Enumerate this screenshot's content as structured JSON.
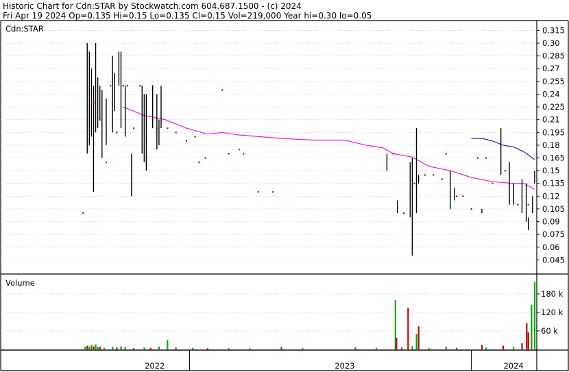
{
  "header": {
    "line1": "Historic Chart for Cdn:STAR by Stockwatch.com 604.687.1500 - (c) 2024",
    "line2": "Fri Apr 19 2024   Op=0.135   Hi=0.15   Lo=0.135   Cl=0.15   Vol=219,000   Year hi=0.30   lo=0.05"
  },
  "colors": {
    "background": "#ffffff",
    "grid": "#c8c8c8",
    "price_bar": "#000000",
    "price_dot": "#cc0000",
    "ma_long": "#e020e0",
    "ma_short": "#2020c0",
    "volume_up": "#00aa00",
    "volume_down": "#cc0000",
    "volume_flat": "#000000"
  },
  "chart_data": [
    {
      "type": "ohlc",
      "panel": "price",
      "symbol_label": "Cdn:STAR",
      "ylim": [
        0.03,
        0.325
      ],
      "y_ticks": [
        "0.315",
        "0.30",
        "0.285",
        "0.27",
        "0.255",
        "0.24",
        "0.225",
        "0.21",
        "0.195",
        "0.18",
        "0.165",
        "0.15",
        "0.135",
        "0.12",
        "0.105",
        "0.09",
        "0.075",
        "0.06",
        "0.045"
      ],
      "grid": true,
      "x_range": [
        2021.77,
        2024.31
      ],
      "bars": [
        {
          "x": 2022.18,
          "hi": 0.3,
          "lo": 0.17
        },
        {
          "x": 2022.19,
          "hi": 0.29,
          "lo": 0.18
        },
        {
          "x": 2022.2,
          "hi": 0.27,
          "lo": 0.19
        },
        {
          "x": 2022.21,
          "hi": 0.25,
          "lo": 0.125
        },
        {
          "x": 2022.22,
          "hi": 0.3,
          "lo": 0.195
        },
        {
          "x": 2022.23,
          "hi": 0.26,
          "lo": 0.2
        },
        {
          "x": 2022.24,
          "hi": 0.25,
          "lo": 0.21
        },
        {
          "x": 2022.25,
          "hi": 0.245,
          "lo": 0.165
        },
        {
          "x": 2022.27,
          "hi": 0.235,
          "lo": 0.18
        },
        {
          "x": 2022.3,
          "hi": 0.285,
          "lo": 0.195
        },
        {
          "x": 2022.31,
          "hi": 0.265,
          "lo": 0.22
        },
        {
          "x": 2022.33,
          "hi": 0.29,
          "lo": 0.25
        },
        {
          "x": 2022.34,
          "hi": 0.29,
          "lo": 0.2
        },
        {
          "x": 2022.36,
          "hi": 0.25,
          "lo": 0.19
        },
        {
          "x": 2022.39,
          "hi": 0.17,
          "lo": 0.12
        },
        {
          "x": 2022.44,
          "hi": 0.25,
          "lo": 0.17
        },
        {
          "x": 2022.45,
          "hi": 0.24,
          "lo": 0.16
        },
        {
          "x": 2022.46,
          "hi": 0.24,
          "lo": 0.15
        },
        {
          "x": 2022.49,
          "hi": 0.25,
          "lo": 0.2
        },
        {
          "x": 2022.51,
          "hi": 0.24,
          "lo": 0.175
        },
        {
          "x": 2022.52,
          "hi": 0.21,
          "lo": 0.18
        },
        {
          "x": 2022.53,
          "hi": 0.25,
          "lo": 0.2
        },
        {
          "x": 2023.6,
          "hi": 0.17,
          "lo": 0.15
        },
        {
          "x": 2023.65,
          "hi": 0.115,
          "lo": 0.1
        },
        {
          "x": 2023.71,
          "hi": 0.16,
          "lo": 0.095
        },
        {
          "x": 2023.72,
          "hi": 0.165,
          "lo": 0.05
        },
        {
          "x": 2023.74,
          "hi": 0.2,
          "lo": 0.1
        },
        {
          "x": 2023.75,
          "hi": 0.145,
          "lo": 0.135
        },
        {
          "x": 2023.9,
          "hi": 0.15,
          "lo": 0.105
        },
        {
          "x": 2023.92,
          "hi": 0.13,
          "lo": 0.115
        },
        {
          "x": 2024.05,
          "hi": 0.105,
          "lo": 0.1
        },
        {
          "x": 2024.14,
          "hi": 0.2,
          "lo": 0.145
        },
        {
          "x": 2024.18,
          "hi": 0.16,
          "lo": 0.11
        },
        {
          "x": 2024.2,
          "hi": 0.135,
          "lo": 0.11
        },
        {
          "x": 2024.24,
          "hi": 0.14,
          "lo": 0.1
        },
        {
          "x": 2024.26,
          "hi": 0.135,
          "lo": 0.09
        },
        {
          "x": 2024.27,
          "hi": 0.095,
          "lo": 0.08
        },
        {
          "x": 2024.29,
          "hi": 0.12,
          "lo": 0.1
        },
        {
          "x": 2024.3,
          "hi": 0.15,
          "lo": 0.135
        }
      ],
      "dots": [
        [
          2022.16,
          0.1
        ],
        [
          2022.21,
          0.23
        ],
        [
          2022.24,
          0.21
        ],
        [
          2022.27,
          0.16
        ],
        [
          2022.29,
          0.25
        ],
        [
          2022.32,
          0.195
        ],
        [
          2022.35,
          0.25
        ],
        [
          2022.37,
          0.25
        ],
        [
          2022.4,
          0.2
        ],
        [
          2022.43,
          0.25
        ],
        [
          2022.46,
          0.165
        ],
        [
          2022.49,
          0.25
        ],
        [
          2022.51,
          0.2
        ],
        [
          2022.53,
          0.21
        ],
        [
          2022.56,
          0.2
        ],
        [
          2022.6,
          0.195
        ],
        [
          2022.65,
          0.185
        ],
        [
          2022.69,
          0.19
        ],
        [
          2022.71,
          0.16
        ],
        [
          2022.74,
          0.165
        ],
        [
          2022.82,
          0.245
        ],
        [
          2022.85,
          0.17
        ],
        [
          2022.9,
          0.175
        ],
        [
          2022.92,
          0.17
        ],
        [
          2022.99,
          0.125
        ],
        [
          2023.06,
          0.125
        ],
        [
          2023.63,
          0.17
        ],
        [
          2023.68,
          0.1
        ],
        [
          2023.73,
          0.135
        ],
        [
          2023.78,
          0.145
        ],
        [
          2023.82,
          0.145
        ],
        [
          2023.86,
          0.14
        ],
        [
          2023.88,
          0.17
        ],
        [
          2023.93,
          0.12
        ],
        [
          2023.96,
          0.12
        ],
        [
          2024.0,
          0.105
        ],
        [
          2024.03,
          0.165
        ],
        [
          2024.07,
          0.165
        ],
        [
          2024.1,
          0.135
        ],
        [
          2024.16,
          0.15
        ],
        [
          2024.22,
          0.11
        ],
        [
          2024.27,
          0.11
        ]
      ],
      "series": [
        {
          "color_key": "ma_long",
          "points": [
            [
              2022.35,
              0.225
            ],
            [
              2022.45,
              0.215
            ],
            [
              2022.55,
              0.21
            ],
            [
              2022.65,
              0.2
            ],
            [
              2022.75,
              0.193
            ],
            [
              2022.82,
              0.195
            ],
            [
              2022.9,
              0.192
            ],
            [
              2023.0,
              0.19
            ],
            [
              2023.1,
              0.188
            ],
            [
              2023.25,
              0.186
            ],
            [
              2023.4,
              0.186
            ],
            [
              2023.5,
              0.18
            ],
            [
              2023.58,
              0.177
            ],
            [
              2023.63,
              0.17
            ],
            [
              2023.72,
              0.166
            ],
            [
              2023.8,
              0.155
            ],
            [
              2023.9,
              0.15
            ],
            [
              2024.0,
              0.142
            ],
            [
              2024.1,
              0.137
            ],
            [
              2024.2,
              0.135
            ],
            [
              2024.25,
              0.135
            ],
            [
              2024.3,
              0.128
            ]
          ]
        },
        {
          "color_key": "ma_short",
          "points": [
            [
              2024.0,
              0.188
            ],
            [
              2024.05,
              0.188
            ],
            [
              2024.1,
              0.185
            ],
            [
              2024.15,
              0.18
            ],
            [
              2024.2,
              0.178
            ],
            [
              2024.25,
              0.172
            ],
            [
              2024.3,
              0.163
            ]
          ]
        }
      ]
    },
    {
      "type": "bar",
      "panel": "volume",
      "panel_label": "Volume",
      "ylim": [
        0,
        240000
      ],
      "y_ticks": [
        "180 k",
        "120 k",
        "60 k"
      ],
      "grid": true,
      "bars": [
        {
          "x": 2022.17,
          "v": 8000,
          "c": "volume_up"
        },
        {
          "x": 2022.18,
          "v": 12000,
          "c": "volume_down"
        },
        {
          "x": 2022.19,
          "v": 9000,
          "c": "volume_up"
        },
        {
          "x": 2022.2,
          "v": 14000,
          "c": "volume_up"
        },
        {
          "x": 2022.21,
          "v": 10000,
          "c": "volume_down"
        },
        {
          "x": 2022.22,
          "v": 16000,
          "c": "volume_up"
        },
        {
          "x": 2022.23,
          "v": 7000,
          "c": "volume_up"
        },
        {
          "x": 2022.24,
          "v": 9000,
          "c": "volume_down"
        },
        {
          "x": 2022.26,
          "v": 5000,
          "c": "volume_up"
        },
        {
          "x": 2022.3,
          "v": 8000,
          "c": "volume_up"
        },
        {
          "x": 2022.32,
          "v": 6000,
          "c": "volume_down"
        },
        {
          "x": 2022.34,
          "v": 10000,
          "c": "volume_up"
        },
        {
          "x": 2022.36,
          "v": 7000,
          "c": "volume_up"
        },
        {
          "x": 2022.4,
          "v": 4000,
          "c": "volume_down"
        },
        {
          "x": 2022.45,
          "v": 6000,
          "c": "volume_up"
        },
        {
          "x": 2022.48,
          "v": 5000,
          "c": "volume_down"
        },
        {
          "x": 2022.52,
          "v": 9000,
          "c": "volume_up"
        },
        {
          "x": 2022.56,
          "v": 30000,
          "c": "volume_up"
        },
        {
          "x": 2022.6,
          "v": 6000,
          "c": "volume_down"
        },
        {
          "x": 2022.68,
          "v": 5000,
          "c": "volume_up"
        },
        {
          "x": 2022.75,
          "v": 4000,
          "c": "volume_down"
        },
        {
          "x": 2022.85,
          "v": 4000,
          "c": "volume_up"
        },
        {
          "x": 2022.95,
          "v": 3000,
          "c": "volume_down"
        },
        {
          "x": 2023.1,
          "v": 7000,
          "c": "volume_down"
        },
        {
          "x": 2023.2,
          "v": 4000,
          "c": "volume_up"
        },
        {
          "x": 2023.45,
          "v": 6000,
          "c": "volume_down"
        },
        {
          "x": 2023.55,
          "v": 5000,
          "c": "volume_up"
        },
        {
          "x": 2023.64,
          "v": 160000,
          "c": "volume_up"
        },
        {
          "x": 2023.645,
          "v": 38000,
          "c": "volume_down"
        },
        {
          "x": 2023.67,
          "v": 6000,
          "c": "volume_down"
        },
        {
          "x": 2023.7,
          "v": 135000,
          "c": "volume_down"
        },
        {
          "x": 2023.72,
          "v": 10000,
          "c": "volume_up"
        },
        {
          "x": 2023.74,
          "v": 50000,
          "c": "volume_up"
        },
        {
          "x": 2023.75,
          "v": 75000,
          "c": "volume_down"
        },
        {
          "x": 2023.8,
          "v": 4000,
          "c": "volume_up"
        },
        {
          "x": 2023.88,
          "v": 9000,
          "c": "volume_up"
        },
        {
          "x": 2023.93,
          "v": 5000,
          "c": "volume_down"
        },
        {
          "x": 2024.05,
          "v": 14000,
          "c": "volume_down"
        },
        {
          "x": 2024.07,
          "v": 6000,
          "c": "volume_up"
        },
        {
          "x": 2024.15,
          "v": 12000,
          "c": "volume_down"
        },
        {
          "x": 2024.2,
          "v": 7000,
          "c": "volume_up"
        },
        {
          "x": 2024.24,
          "v": 20000,
          "c": "volume_down"
        },
        {
          "x": 2024.262,
          "v": 85000,
          "c": "volume_down"
        },
        {
          "x": 2024.27,
          "v": 55000,
          "c": "volume_down"
        },
        {
          "x": 2024.285,
          "v": 145000,
          "c": "volume_up"
        },
        {
          "x": 2024.3,
          "v": 219000,
          "c": "volume_up"
        }
      ]
    }
  ],
  "x_axis": {
    "year_labels": [
      {
        "label": "2022",
        "x": 2022.5
      },
      {
        "label": "2023",
        "x": 2023.4
      },
      {
        "label": "2024",
        "x": 2024.2
      }
    ],
    "year_dividers": [
      2022.665,
      2024.0
    ]
  }
}
